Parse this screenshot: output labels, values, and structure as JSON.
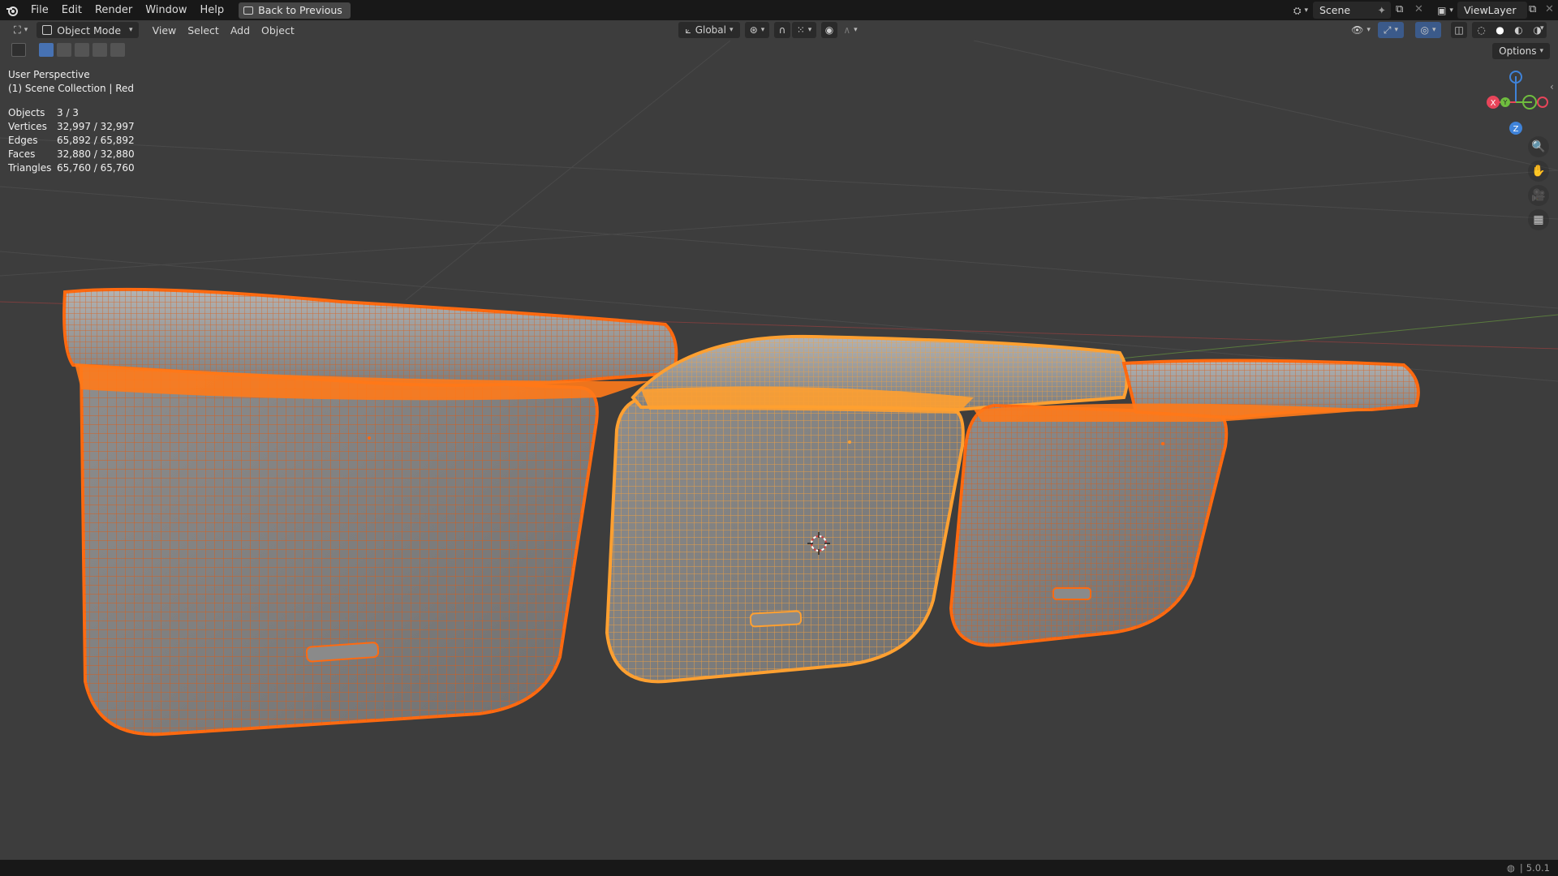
{
  "menubar": {
    "items": [
      "File",
      "Edit",
      "Render",
      "Window",
      "Help"
    ],
    "back_button": "Back to Previous",
    "scene_name": "Scene",
    "view_layer": "ViewLayer"
  },
  "header": {
    "mode": "Object Mode",
    "menus": [
      "View",
      "Select",
      "Add",
      "Object"
    ],
    "transform_orientation": "Global",
    "options_label": "Options"
  },
  "viewport": {
    "view_name": "User Perspective",
    "collection": "(1) Scene Collection | Red",
    "stats": [
      {
        "label": "Objects",
        "value": "3 / 3"
      },
      {
        "label": "Vertices",
        "value": "32,997 / 32,997"
      },
      {
        "label": "Edges",
        "value": "65,892 / 65,892"
      },
      {
        "label": "Faces",
        "value": "32,880 / 32,880"
      },
      {
        "label": "Triangles",
        "value": "65,760 / 65,760"
      }
    ],
    "gizmo": {
      "x": "X",
      "y": "Y",
      "z": "Z"
    }
  },
  "statusbar": {
    "version": "5.0.1"
  },
  "colors": {
    "selected": "#ff7a1a",
    "active": "#ffb35a",
    "x_axis": "#e8455a",
    "y_axis": "#6fbd3e",
    "z_axis": "#3f83d9"
  }
}
